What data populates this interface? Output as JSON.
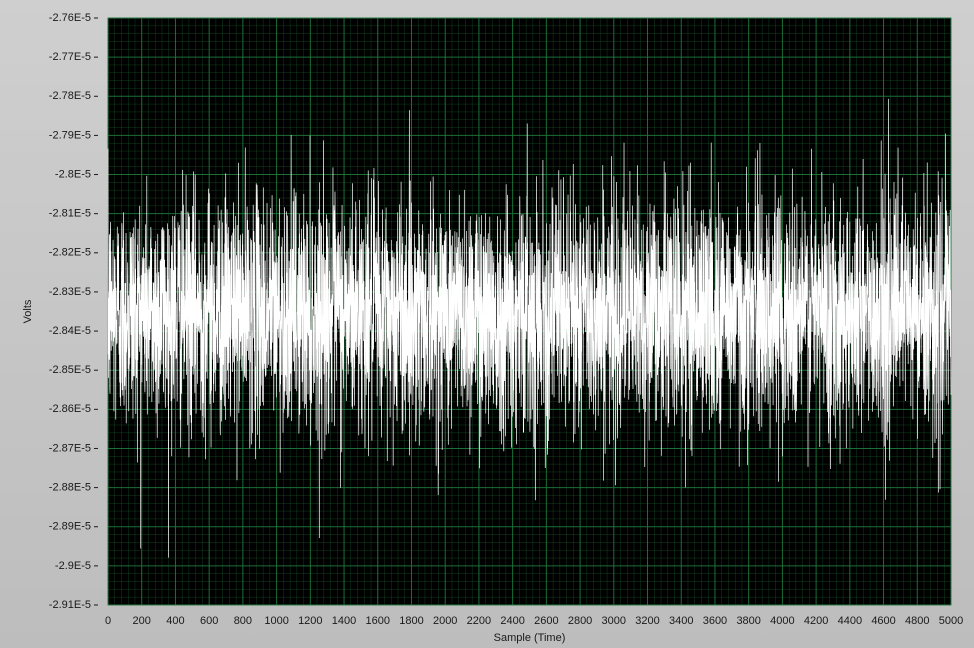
{
  "chart_data": {
    "type": "line",
    "title": "",
    "xlabel": "Sample (Time)",
    "ylabel": "Volts",
    "xlim": [
      0,
      5000
    ],
    "ylim": [
      -2.91e-05,
      -2.76e-05
    ],
    "x_ticks": [
      "0",
      "200",
      "400",
      "600",
      "800",
      "1000",
      "1200",
      "1400",
      "1600",
      "1800",
      "2000",
      "2200",
      "2400",
      "2600",
      "2800",
      "3000",
      "3200",
      "3400",
      "3600",
      "3800",
      "4000",
      "4200",
      "4400",
      "4600",
      "4800",
      "5000"
    ],
    "y_ticks": [
      "-2.76E-5",
      "-2.77E-5",
      "-2.78E-5",
      "-2.79E-5",
      "-2.8E-5",
      "-2.81E-5",
      "-2.82E-5",
      "-2.83E-5",
      "-2.84E-5",
      "-2.85E-5",
      "-2.86E-5",
      "-2.87E-5",
      "-2.88E-5",
      "-2.89E-5",
      "-2.9E-5",
      "-2.91E-5"
    ],
    "grid": true,
    "colors": {
      "plot_bg": "#000000",
      "grid": "#1f7a3c",
      "series": "#ffffff",
      "frame": "#c7c7c7"
    },
    "series": [
      {
        "n_samples": 5000,
        "mean": -2.835e-05,
        "noise_std": 1.5e-07,
        "min": -2.9075e-05,
        "max": -2.7648e-05
      }
    ]
  }
}
